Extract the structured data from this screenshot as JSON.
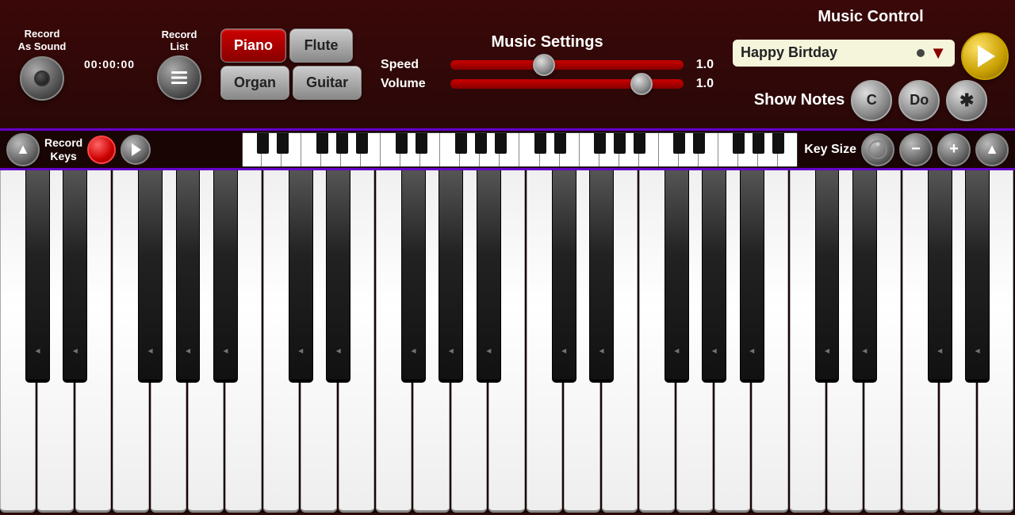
{
  "topbar": {
    "record_as_sound": "Record\nAs Sound",
    "record_as_sound_line1": "Record",
    "record_as_sound_line2": "As Sound",
    "timer": "00:00:00",
    "record_list_line1": "Record",
    "record_list_line2": "List",
    "instruments": [
      "Piano",
      "Flute",
      "Organ",
      "Guitar"
    ],
    "active_instrument": "Piano",
    "music_settings_title": "Music Settings",
    "speed_label": "Speed",
    "speed_value": "1.0",
    "volume_label": "Volume",
    "volume_value": "1.0",
    "music_control_title": "Music Control",
    "song_name": "Happy Birtday",
    "show_notes_label": "Show Notes",
    "note_c": "C",
    "note_do": "Do"
  },
  "keyboard_strip": {
    "record_keys_line1": "Record",
    "record_keys_line2": "Keys",
    "key_size_label": "Key Size"
  },
  "colors": {
    "bg": "#2a0808",
    "accent_red": "#cc0000",
    "accent_purple": "#6600cc",
    "gold": "#c8a000"
  }
}
